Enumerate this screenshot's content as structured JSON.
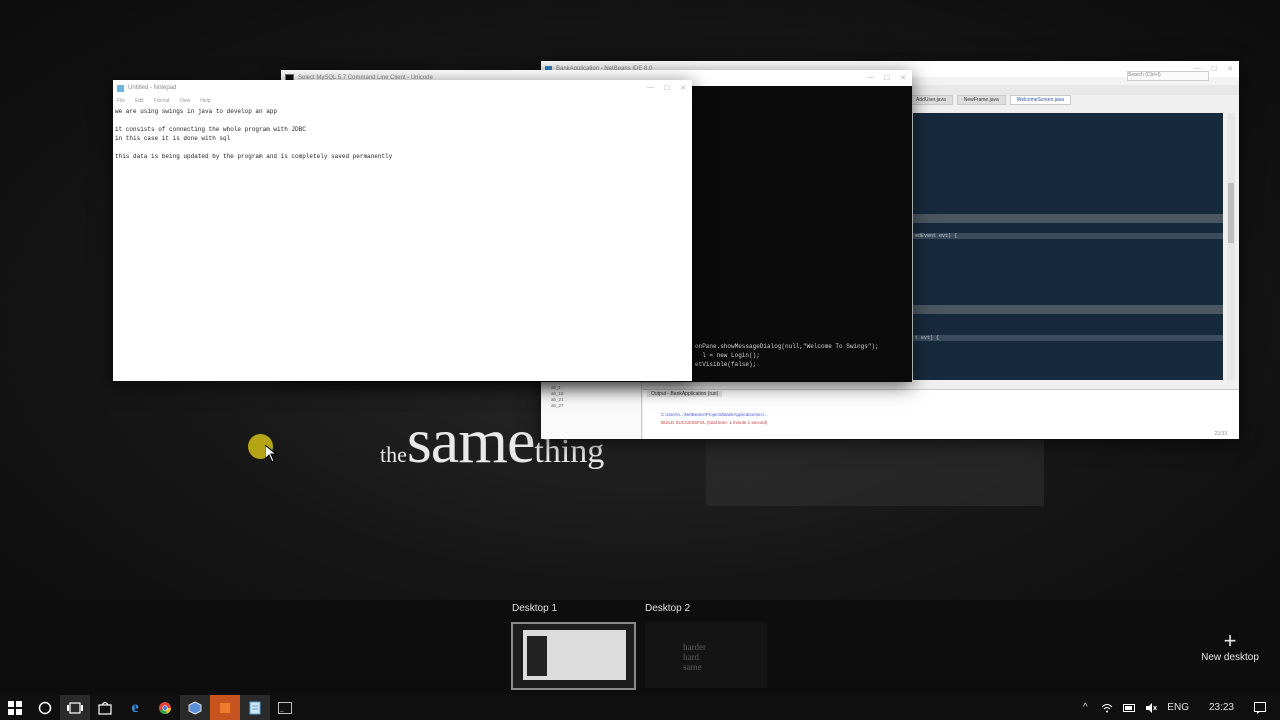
{
  "background": {
    "prefix": "the",
    "word": "same",
    "suffix": "thing"
  },
  "netbeans": {
    "title": "BankApplication - NetBeans IDE 8.0",
    "search_placeholder": "Search (Ctrl+I)",
    "tabs": [
      "AddUser.java",
      "NewFrame.java",
      "WelcomeScreen.java"
    ],
    "code_lines": [
      "edEvent evt) {",
      "t evt) {"
    ],
    "output_tab": "Output - BankApplication (run)",
    "output_line1": "C:\\Users\\...\\NetBeans\\Projects\\BankApplication\\src\\...",
    "output_line2": "BUILD SUCCESSFUL (total time: 1 minute 1 second)",
    "tree_items": [
      "ab_1",
      "ab_16",
      "ab_21",
      "ab_27"
    ],
    "status": "23:33"
  },
  "mysql": {
    "title": "Select MySQL 5.7 Command Line Client - Unicode",
    "console_lines": [
      "onPane.showMessageDialog(null,\"Welcome To Swings\");",
      "  l = new Login();",
      "",
      "etVisible(false);"
    ]
  },
  "notepad": {
    "title": "Untitled - Notepad",
    "menu": [
      "File",
      "Edit",
      "Format",
      "View",
      "Help"
    ],
    "text": "we are using swings in java to develop an app\n\nit consists of connecting the whole program with JDBC\nin this case it is done with sql\n\nthis data is being updated by the program and is completely saved permanently"
  },
  "desktops": [
    {
      "label": "Desktop 1"
    },
    {
      "label": "Desktop 2",
      "preview_text": "harder\nhard\nsame"
    }
  ],
  "new_desktop_label": "New desktop",
  "taskbar": {
    "apps": [
      "windows-start",
      "cortana",
      "task-view",
      "store",
      "edge",
      "chrome",
      "virtualbox",
      "sublime",
      "notepad",
      "cmd"
    ],
    "lang": "ENG",
    "time": "23:23"
  }
}
